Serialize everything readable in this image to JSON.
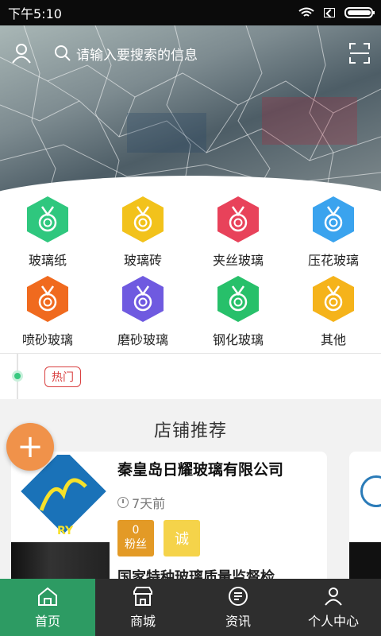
{
  "status_bar": {
    "time": "下午5:10"
  },
  "search": {
    "placeholder": "请输入要搜索的信息"
  },
  "categories": [
    {
      "label": "玻璃纸",
      "color": "#2fc77e"
    },
    {
      "label": "玻璃砖",
      "color": "#f2c21b"
    },
    {
      "label": "夹丝玻璃",
      "color": "#e8425a"
    },
    {
      "label": "压花玻璃",
      "color": "#3aa3ee"
    },
    {
      "label": "喷砂玻璃",
      "color": "#f06a1e"
    },
    {
      "label": "磨砂玻璃",
      "color": "#6f5ae0"
    },
    {
      "label": "钢化玻璃",
      "color": "#27c06a"
    },
    {
      "label": "其他",
      "color": "#f5b31a"
    }
  ],
  "hot": {
    "tag": "热门"
  },
  "shops": {
    "title": "店铺推荐",
    "card": {
      "name": "秦皇岛日耀玻璃有限公司",
      "time": "7天前",
      "fans_count": "0",
      "fans_label": "粉丝",
      "cheng": "诚",
      "desc": "国家特种玻璃质量监督检..."
    }
  },
  "nav": [
    {
      "label": "首页",
      "icon": "home-icon"
    },
    {
      "label": "商城",
      "icon": "store-icon"
    },
    {
      "label": "资讯",
      "icon": "news-icon"
    },
    {
      "label": "个人中心",
      "icon": "user-center-icon"
    }
  ],
  "fab": "+",
  "colors": {
    "active_nav": "#2d9b63",
    "fab": "#f0924a",
    "hot": "#d94040"
  }
}
